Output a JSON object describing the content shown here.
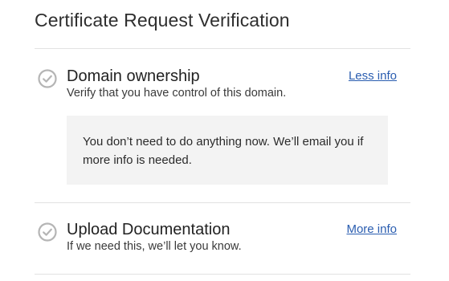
{
  "page": {
    "title": "Certificate Request Verification"
  },
  "steps": [
    {
      "title": "Domain ownership",
      "subtitle": "Verify that you have control of this domain.",
      "link_label": "Less info",
      "status_icon": "check-circle-icon",
      "expanded": true,
      "details": "You don’t need to do anything now. We’ll email you if more info is needed."
    },
    {
      "title": "Upload Documentation",
      "subtitle": "If we need this, we’ll let you know.",
      "link_label": "More info",
      "status_icon": "check-circle-icon",
      "expanded": false
    }
  ],
  "colors": {
    "link": "#2a5db0",
    "icon": "#b5b5b5",
    "divider": "#e2e2e2",
    "info_box_bg": "#f3f3f3"
  }
}
